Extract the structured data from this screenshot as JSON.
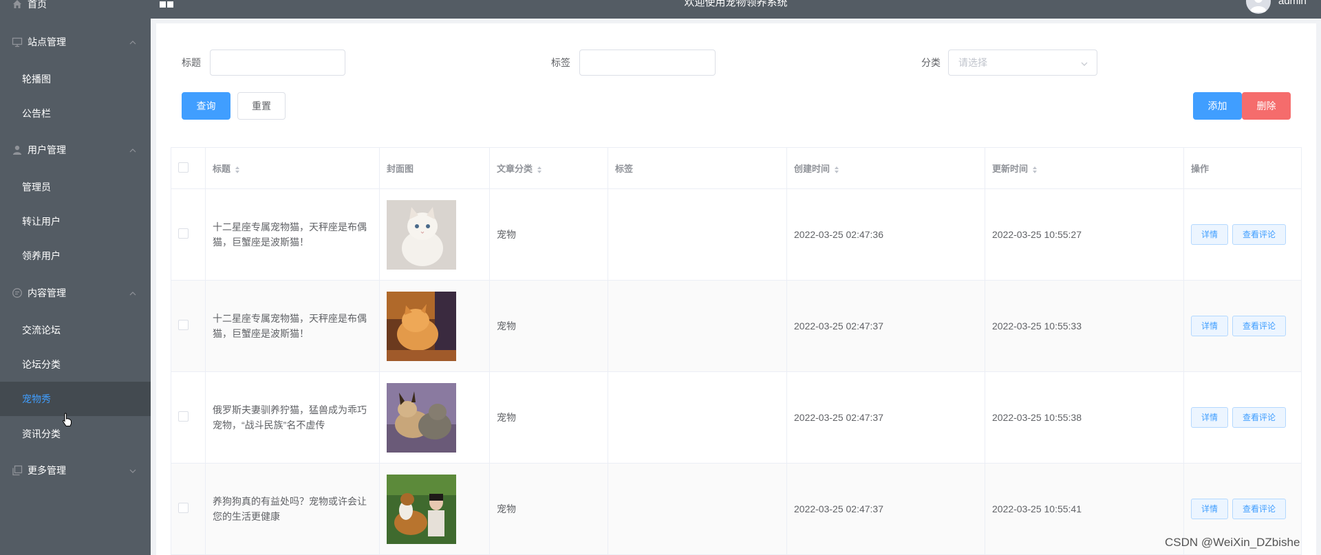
{
  "header": {
    "title": "欢迎使用宠物领养系统",
    "username": "admin"
  },
  "sidebar": {
    "items": [
      {
        "label": "首页",
        "icon": "home-icon",
        "type": "group"
      },
      {
        "label": "站点管理",
        "icon": "monitor-icon",
        "type": "group"
      },
      {
        "label": "轮播图",
        "type": "sub"
      },
      {
        "label": "公告栏",
        "type": "sub"
      },
      {
        "label": "用户管理",
        "icon": "user-icon",
        "type": "group"
      },
      {
        "label": "管理员",
        "type": "sub"
      },
      {
        "label": "转让用户",
        "type": "sub"
      },
      {
        "label": "领养用户",
        "type": "sub"
      },
      {
        "label": "内容管理",
        "icon": "chat-icon",
        "type": "group"
      },
      {
        "label": "交流论坛",
        "type": "sub"
      },
      {
        "label": "论坛分类",
        "type": "sub"
      },
      {
        "label": "宠物秀",
        "type": "sub",
        "active": true
      },
      {
        "label": "资讯分类",
        "type": "sub"
      },
      {
        "label": "更多管理",
        "icon": "copy-icon",
        "type": "group"
      }
    ]
  },
  "filters": {
    "title_label": "标题",
    "tag_label": "标签",
    "category_label": "分类",
    "category_placeholder": "请选择",
    "title_value": "",
    "tag_value": ""
  },
  "actions": {
    "query": "查询",
    "reset": "重置",
    "add": "添加",
    "delete": "删除"
  },
  "table": {
    "headers": [
      "标题",
      "封面图",
      "文章分类",
      "标签",
      "创建时间",
      "更新时间",
      "操作"
    ],
    "rows": [
      {
        "title": "十二星座专属宠物猫，天秤座是布偶猫，巨蟹座是波斯猫！",
        "category": "宠物",
        "tag": "",
        "created": "2022-03-25 02:47:36",
        "updated": "2022-03-25 10:55:27"
      },
      {
        "title": "十二星座专属宠物猫，天秤座是布偶猫，巨蟹座是波斯猫！",
        "category": "宠物",
        "tag": "",
        "created": "2022-03-25 02:47:37",
        "updated": "2022-03-25 10:55:33"
      },
      {
        "title": "俄罗斯夫妻驯养狞猫，猛兽成为乖巧宠物，“战斗民族”名不虚传",
        "category": "宠物",
        "tag": "",
        "created": "2022-03-25 02:47:37",
        "updated": "2022-03-25 10:55:38"
      },
      {
        "title": "养狗狗真的有益处吗？宠物或许会让您的生活更健康",
        "category": "宠物",
        "tag": "",
        "created": "2022-03-25 02:47:37",
        "updated": "2022-03-25 10:55:41"
      }
    ],
    "row_detail": "详情",
    "row_comments": "查看评论"
  },
  "watermark": "CSDN @WeiXin_DZbishe",
  "colors": {
    "sidebar_bg": "#545c64",
    "primary": "#409eff",
    "danger": "#f56c6c"
  }
}
